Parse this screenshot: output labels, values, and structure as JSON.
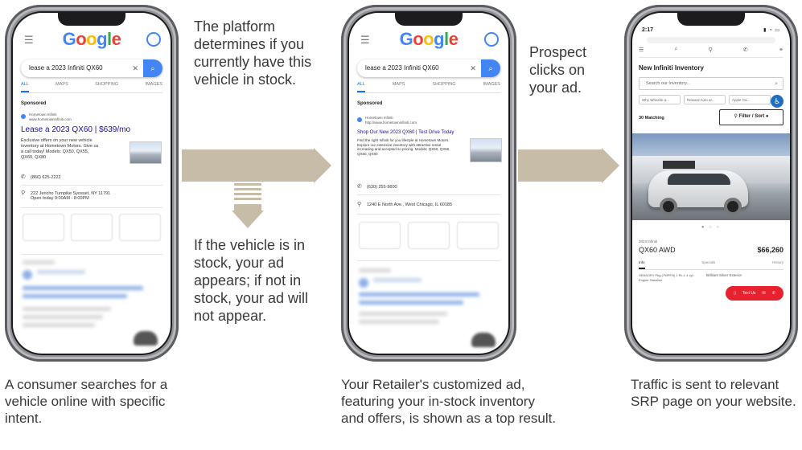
{
  "step1": {
    "search_query": "lease a 2023 Infiniti QX60",
    "logo": [
      "G",
      "o",
      "o",
      "g",
      "l",
      "e"
    ],
    "tabs": [
      "ALL",
      "MAPS",
      "SHOPPING",
      "IMAGES"
    ],
    "sponsored_label": "Sponsored",
    "advertiser": "Hometown Infiniti",
    "advertiser_url": "www.hometowninfiniti.com",
    "ad_headline": "Lease a 2023 QX60 | $639/mo",
    "ad_body": "Exclusive offers on your new vehicle inventory at Hometown Motors. Give us a call today! Models: QX50, QX55, QX60, QX80",
    "phone": "(866) 625-2222",
    "address": "222 Jericho Turnpike Syosset, NY 11791",
    "hours": "Open today 9:00AM - 8:00PM",
    "caption": "A consumer searches for a vehicle online with specific intent."
  },
  "step2": {
    "search_query": "lease a 2023 Infiniti QX60",
    "logo": [
      "G",
      "o",
      "o",
      "g",
      "l",
      "e"
    ],
    "tabs": [
      "ALL",
      "MAPS",
      "SHOPPING",
      "IMAGES"
    ],
    "sponsored_label": "Sponsored",
    "advertiser": "Hometown Infiniti",
    "advertiser_url": "http://www.hometowninfiniti.com",
    "ad_headline": "Shop Our New 2023 QX60 | Test Drive Today",
    "ad_body": "Find the right Infiniti for you lifestyle at Hometown Motors. Explore our extensive inventory with attractive rental increasing and accepted so pricing. Models: QX50, QX55, QX60, QX80",
    "phone": "(630) 255-9600",
    "address": "1240 E North Ave., West Chicago, IL 60185",
    "caption": "Your Retailer's customized ad, featuring your in-stock inventory and offers, is shown as a top result."
  },
  "step3": {
    "time": "2:17",
    "nav_icons": [
      "☰",
      "⌕",
      "⚲",
      "✆",
      "⚭"
    ],
    "inventory_title": "New Infiniti Inventory",
    "search_placeholder": "Search our Inventory...",
    "chips": [
      "Why Wheelie a...",
      "Reward Auto ar...",
      "Apple Ca..."
    ],
    "matching": "30 Matching",
    "filter_label": "Filter / Sort",
    "year_make": "2023 Infiniti",
    "model": "QX60 AWD",
    "price": "$66,260",
    "tabs": [
      "Info",
      "Specials",
      "History"
    ],
    "specs": "SENSORY Pkg (7WPFN) 1 RL-L 4 cyl Engine Gasoline",
    "kbb": "Brilliant Silver Exterior",
    "cta_text": "Text Us",
    "caption": "Traffic is sent to relevant SRP page on your website."
  },
  "annotations": {
    "platform": "The platform determines if you currently have this vehicle in stock.",
    "in_stock": "If the vehicle is in stock, your ad appears; if not in stock, your ad will not appear.",
    "prospect": "Prospect clicks on your ad."
  },
  "colors": {
    "arrow": "#c6bca8",
    "google_blue": "#4285f4",
    "cta_red": "#e8212f"
  }
}
